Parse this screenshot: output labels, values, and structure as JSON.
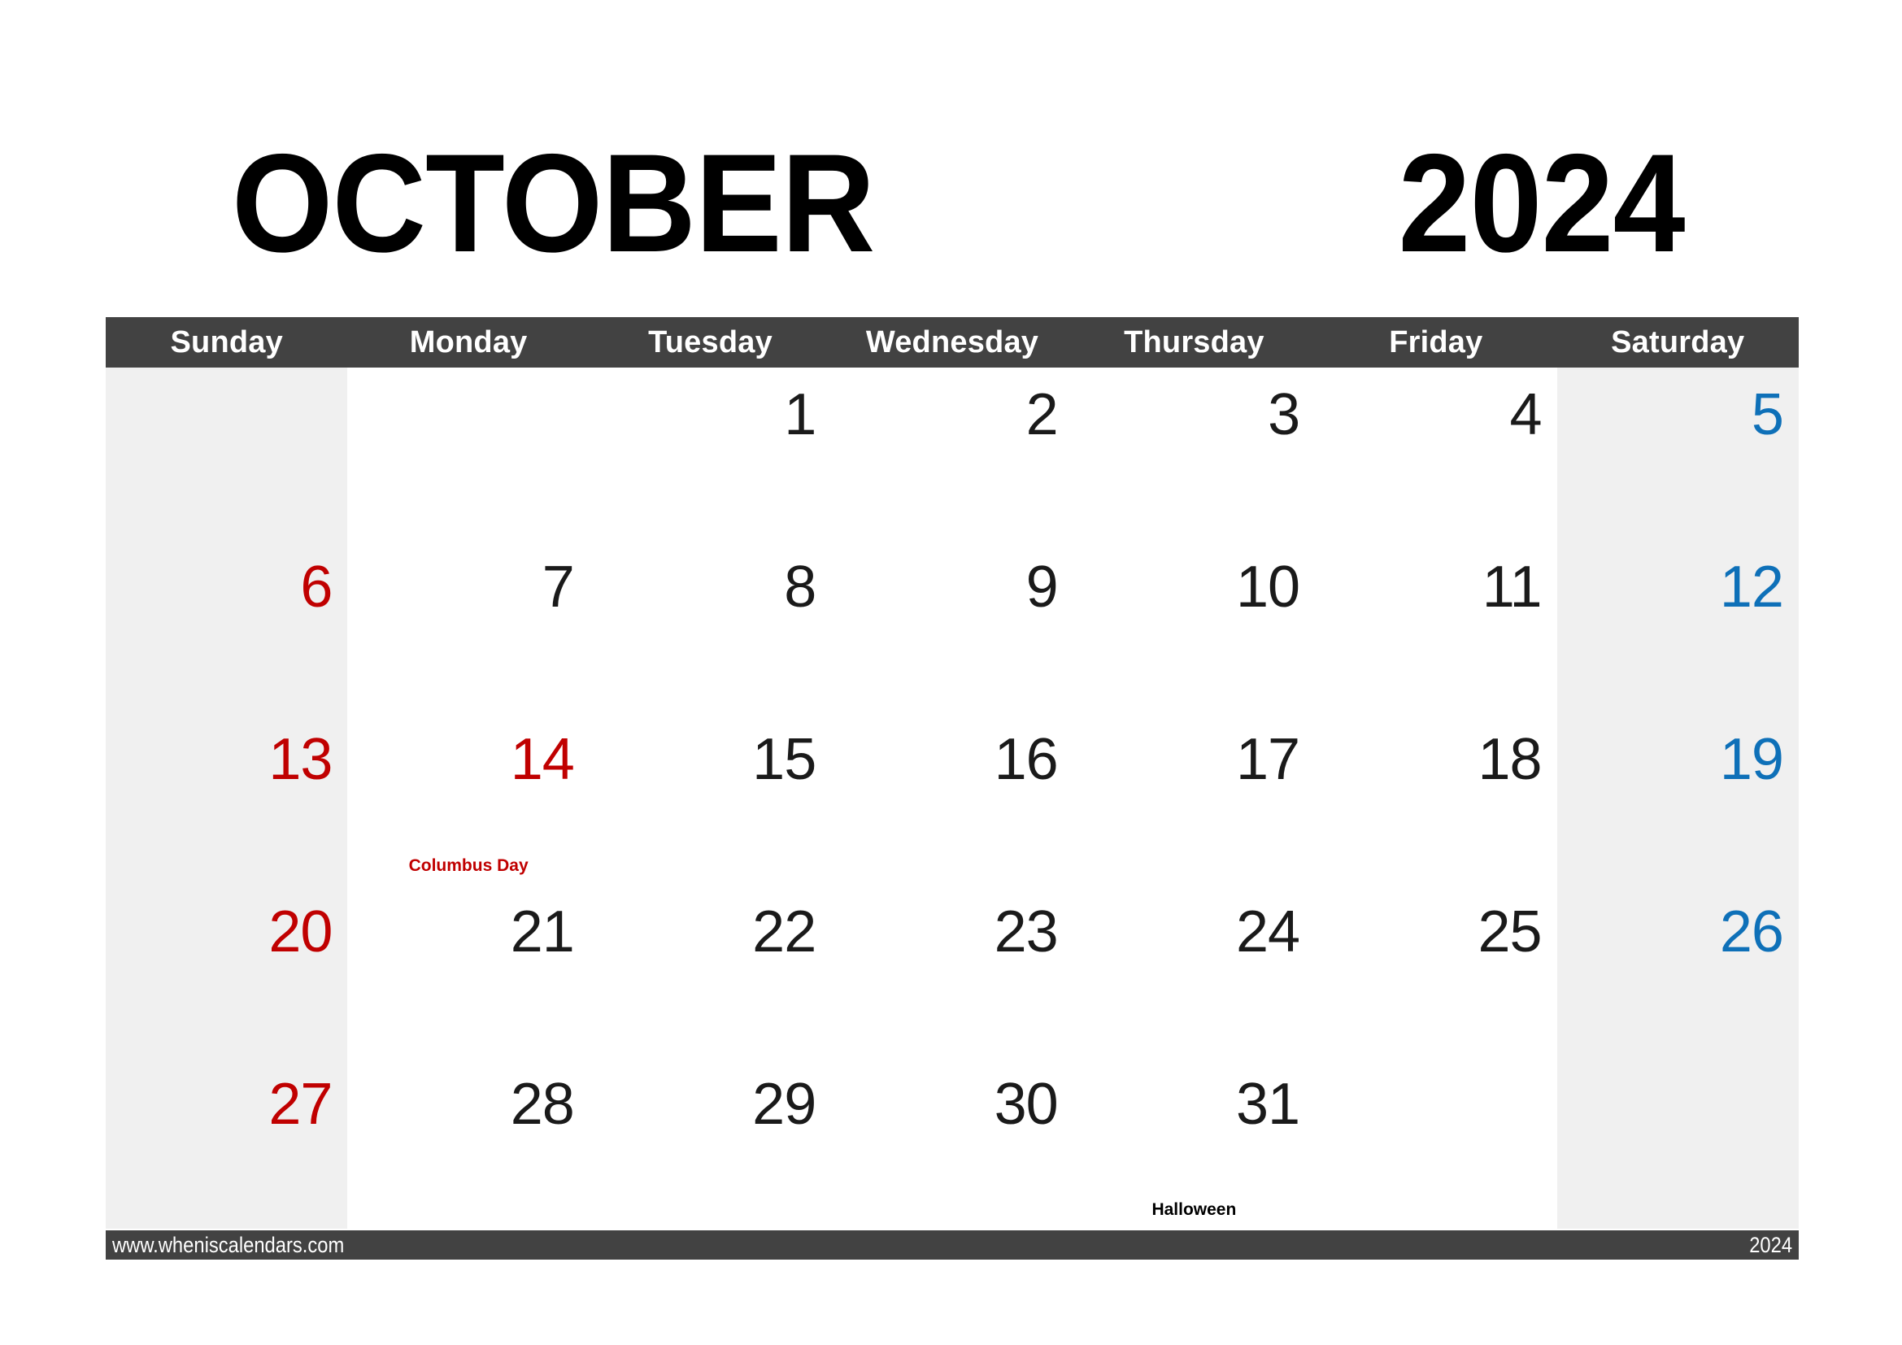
{
  "title": {
    "month": "OCTOBER",
    "year": "2024"
  },
  "colors": {
    "header_bar": "#424242",
    "weekend_background": "#f0f0f0",
    "sunday_text": "#c00000",
    "saturday_text": "#0e70b8",
    "weekday_text": "#1a1a1a",
    "page_background": "#ffffff",
    "header_text": "#ffffff"
  },
  "weekdays": [
    {
      "label": "Sunday"
    },
    {
      "label": "Monday"
    },
    {
      "label": "Tuesday"
    },
    {
      "label": "Wednesday"
    },
    {
      "label": "Thursday"
    },
    {
      "label": "Friday"
    },
    {
      "label": "Saturday"
    }
  ],
  "weeks": [
    {
      "days": [
        {
          "number": "",
          "event": ""
        },
        {
          "number": "",
          "event": ""
        },
        {
          "number": "1",
          "event": ""
        },
        {
          "number": "2",
          "event": ""
        },
        {
          "number": "3",
          "event": ""
        },
        {
          "number": "4",
          "event": ""
        },
        {
          "number": "5",
          "event": ""
        }
      ]
    },
    {
      "days": [
        {
          "number": "6",
          "event": ""
        },
        {
          "number": "7",
          "event": ""
        },
        {
          "number": "8",
          "event": ""
        },
        {
          "number": "9",
          "event": ""
        },
        {
          "number": "10",
          "event": ""
        },
        {
          "number": "11",
          "event": ""
        },
        {
          "number": "12",
          "event": ""
        }
      ]
    },
    {
      "days": [
        {
          "number": "13",
          "event": ""
        },
        {
          "number": "14",
          "event": "Columbus Day"
        },
        {
          "number": "15",
          "event": ""
        },
        {
          "number": "16",
          "event": ""
        },
        {
          "number": "17",
          "event": ""
        },
        {
          "number": "18",
          "event": ""
        },
        {
          "number": "19",
          "event": ""
        }
      ]
    },
    {
      "days": [
        {
          "number": "20",
          "event": ""
        },
        {
          "number": "21",
          "event": ""
        },
        {
          "number": "22",
          "event": ""
        },
        {
          "number": "23",
          "event": ""
        },
        {
          "number": "24",
          "event": ""
        },
        {
          "number": "25",
          "event": ""
        },
        {
          "number": "26",
          "event": ""
        }
      ]
    },
    {
      "days": [
        {
          "number": "27",
          "event": ""
        },
        {
          "number": "28",
          "event": ""
        },
        {
          "number": "29",
          "event": ""
        },
        {
          "number": "30",
          "event": ""
        },
        {
          "number": "31",
          "event": "Halloween"
        },
        {
          "number": "",
          "event": ""
        },
        {
          "number": "",
          "event": ""
        }
      ]
    }
  ],
  "footer": {
    "url": "www.wheniscalendars.com",
    "year": "2024"
  }
}
